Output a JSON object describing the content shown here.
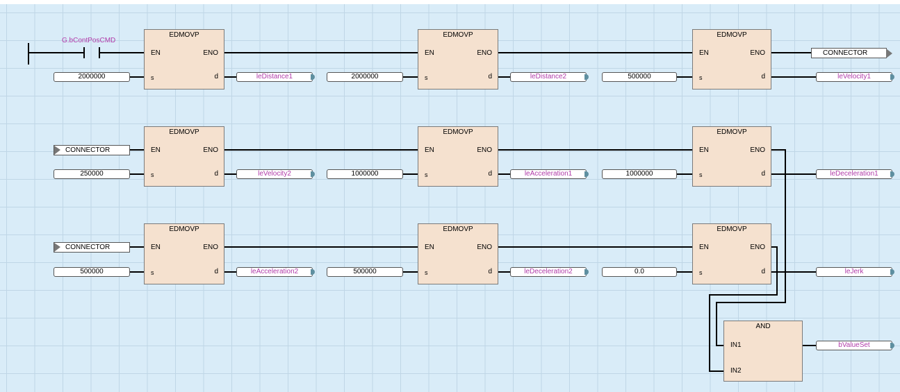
{
  "contact": {
    "label": "G.bContPosCMD"
  },
  "connector_label": "CONNECTOR",
  "blocks": [
    {
      "title": "EDMOVP",
      "pins": [
        "EN",
        "ENO",
        "s",
        "d"
      ],
      "input": "2000000",
      "output": "leDistance1"
    },
    {
      "title": "EDMOVP",
      "pins": [
        "EN",
        "ENO",
        "s",
        "d"
      ],
      "input": "2000000",
      "output": "leDistance2"
    },
    {
      "title": "EDMOVP",
      "pins": [
        "EN",
        "ENO",
        "s",
        "d"
      ],
      "input": "500000",
      "output": "leVelocity1"
    },
    {
      "title": "EDMOVP",
      "pins": [
        "EN",
        "ENO",
        "s",
        "d"
      ],
      "input": "250000",
      "output": "leVelocity2"
    },
    {
      "title": "EDMOVP",
      "pins": [
        "EN",
        "ENO",
        "s",
        "d"
      ],
      "input": "1000000",
      "output": "leAcceleration1"
    },
    {
      "title": "EDMOVP",
      "pins": [
        "EN",
        "ENO",
        "s",
        "d"
      ],
      "input": "1000000",
      "output": "leDeceleration1"
    },
    {
      "title": "EDMOVP",
      "pins": [
        "EN",
        "ENO",
        "s",
        "d"
      ],
      "input": "500000",
      "output": "leAcceleration2"
    },
    {
      "title": "EDMOVP",
      "pins": [
        "EN",
        "ENO",
        "s",
        "d"
      ],
      "input": "500000",
      "output": "leDeceleration2"
    },
    {
      "title": "EDMOVP",
      "pins": [
        "EN",
        "ENO",
        "s",
        "d"
      ],
      "input": "0.0",
      "output": "leJerk"
    }
  ],
  "and_block": {
    "title": "AND",
    "in1": "IN1",
    "in2": "IN2",
    "output": "bValueSet"
  }
}
